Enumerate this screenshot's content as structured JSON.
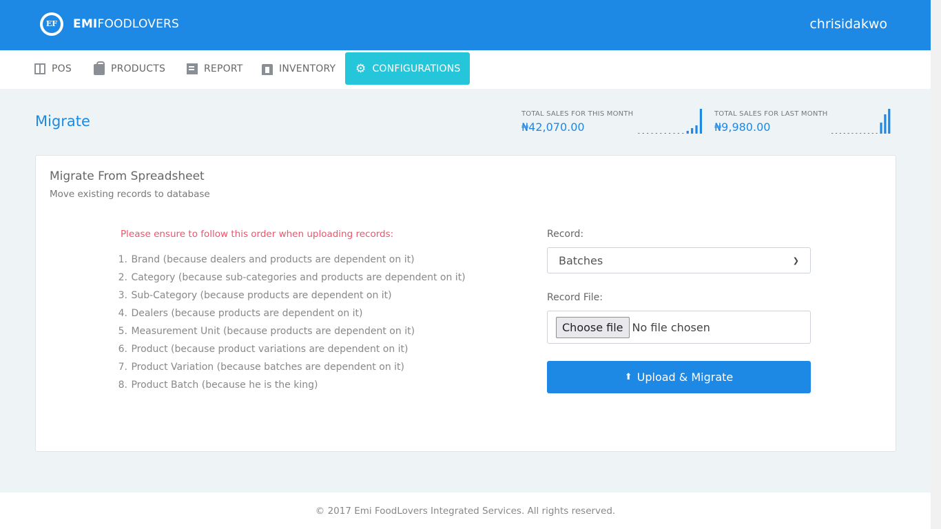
{
  "header": {
    "logo_initials": "EF",
    "brand_bold": "EMI",
    "brand_light": "FOODLOVERS",
    "username": "chrisidakwo",
    "color": "#1e88e5"
  },
  "nav": {
    "items": [
      {
        "label": "POS",
        "icon": "pos-icon"
      },
      {
        "label": "PRODUCTS",
        "icon": "bag-icon"
      },
      {
        "label": "REPORT",
        "icon": "report-icon"
      },
      {
        "label": "INVENTORY",
        "icon": "inventory-icon"
      },
      {
        "label": "CONFIGURATIONS",
        "icon": "gear-icon",
        "active": true
      }
    ],
    "active_color": "#26c6da"
  },
  "page": {
    "title": "Migrate"
  },
  "stats": [
    {
      "label": "TOTAL SALES FOR THIS MONTH",
      "value": "₦42,070.00",
      "sparkline": [
        0,
        0,
        0,
        0,
        0,
        0,
        0,
        0,
        0,
        0,
        0,
        1,
        2,
        3,
        9
      ]
    },
    {
      "label": "TOTAL SALES FOR LAST MONTH",
      "value": "₦9,980.00",
      "sparkline": [
        0,
        0,
        0,
        0,
        0,
        0,
        0,
        0,
        0,
        0,
        0,
        0,
        4,
        7,
        9
      ]
    }
  ],
  "card": {
    "title": "Migrate From Spreadsheet",
    "subtitle": "Move existing records to database",
    "notice": "Please ensure to follow this order when uploading records:",
    "order": [
      {
        "num": "1.",
        "text": "Brand (because dealers and products are dependent on it)"
      },
      {
        "num": "2.",
        "text": "Category (because sub-categories and products are dependent on it)"
      },
      {
        "num": "3.",
        "text": "Sub-Category (because products are dependent on it)"
      },
      {
        "num": "4.",
        "text": "Dealers (because products are dependent on it)"
      },
      {
        "num": "5.",
        "text": "Measurement Unit (because products are dependent on it)"
      },
      {
        "num": "6.",
        "text": "Product (because product variations are dependent on it)"
      },
      {
        "num": "7.",
        "text": "Product Variation (because batches are dependent on it)"
      },
      {
        "num": "8.",
        "text": "Product Batch (because he is the king)"
      }
    ],
    "record_label": "Record:",
    "record_value": "Batches",
    "file_label": "Record File:",
    "file_button": "Choose file",
    "file_status": "No file chosen",
    "upload_label": "Upload & Migrate"
  },
  "footer": {
    "text": "© 2017 Emi FoodLovers Integrated Services. All rights reserved."
  }
}
